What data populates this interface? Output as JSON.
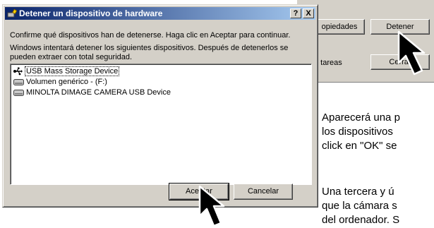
{
  "dialog": {
    "title": "Detener un dispositivo de hardware",
    "help_btn": "?",
    "close_btn": "X",
    "instruction": "Confirme qué dispositivos han de detenerse. Haga clic en Aceptar para continuar.",
    "info_line1": "Windows intentará detener los siguientes dispositivos. Después de detenerlos se",
    "info_line2": "pueden extraer con total seguridad.",
    "devices": [
      {
        "label": "USB Mass Storage Device",
        "icon": "usb-icon"
      },
      {
        "label": "Volumen genérico - (F:)",
        "icon": "drive-icon"
      },
      {
        "label": "MINOLTA DIMAGE CAMERA USB Device",
        "icon": "drive-icon"
      }
    ],
    "accept_label": "Aceptar",
    "cancel_label": "Cancelar"
  },
  "background_window": {
    "properties_label": "opiedades",
    "stop_label": "Detener",
    "tasks_label": "e tareas",
    "close_label": "Cerrar"
  },
  "manual_text": {
    "para1_line1": "Aparecerá una p",
    "para1_line2": "los dispositivos",
    "para1_line3": "click en \"OK\" se",
    "para2_line1": "Una tercera y ú",
    "para2_line2": "que la cámara s",
    "para2_line3": "del ordenador. S"
  }
}
